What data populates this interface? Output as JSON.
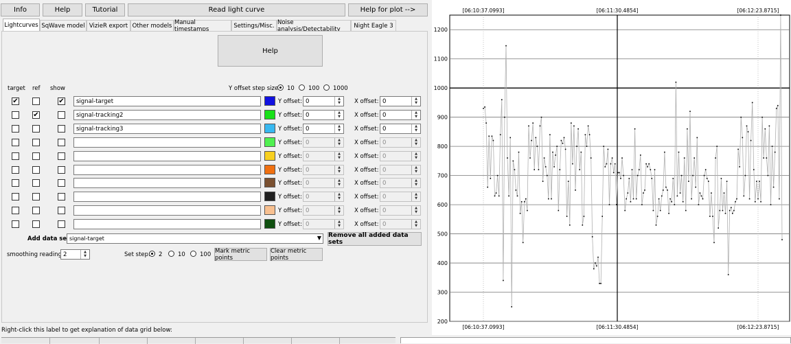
{
  "toolbar": {
    "info": "Info",
    "help": "Help",
    "tutorial": "Tutorial",
    "read_light_curve": "Read light curve",
    "help_for_plot": "Help for plot -->"
  },
  "tabs": [
    "Lightcurves",
    "SqWave model",
    "VizieR export",
    "Other models",
    "Manual timestamps",
    "Settings/Misc.",
    "Noise analysis/Detectability",
    "Night Eagle 3"
  ],
  "panel": {
    "help_button": "Help",
    "col_target": "target",
    "col_ref": "ref",
    "col_show": "show",
    "y_step_label": "Y offset step size:",
    "y_step_options": [
      "10",
      "100",
      "1000"
    ],
    "y_offset_label": "Y offset:",
    "x_offset_label": "X offset:",
    "add_data_set_label": "Add data set",
    "add_data_set_value": "signal-target",
    "remove_all_button": "Remove all added data sets",
    "smoothing_label": "smoothing readings",
    "smoothing_value": "2",
    "set_step_label": "Set step:",
    "set_step_options": [
      "2",
      "10",
      "100"
    ],
    "mark_metric_button": "Mark metric points",
    "clear_metric_button": "Clear metric points",
    "footer_text": "Right-click this label to get explanation of data grid below:"
  },
  "rows": [
    {
      "target": true,
      "ref": false,
      "show": true,
      "name": "signal-target",
      "color": "#1010e0",
      "y": "0",
      "x": "0",
      "enabled": true
    },
    {
      "target": false,
      "ref": true,
      "show": false,
      "name": "signal-tracking2",
      "color": "#18e018",
      "y": "0",
      "x": "0",
      "enabled": true
    },
    {
      "target": false,
      "ref": false,
      "show": false,
      "name": "signal-tracking3",
      "color": "#38b8f0",
      "y": "0",
      "x": "0",
      "enabled": true
    },
    {
      "target": false,
      "ref": false,
      "show": false,
      "name": "",
      "color": "#50f050",
      "y": "0",
      "x": "0",
      "enabled": false
    },
    {
      "target": false,
      "ref": false,
      "show": false,
      "name": "",
      "color": "#f8d020",
      "y": "0",
      "x": "0",
      "enabled": false
    },
    {
      "target": false,
      "ref": false,
      "show": false,
      "name": "",
      "color": "#f07010",
      "y": "0",
      "x": "0",
      "enabled": false
    },
    {
      "target": false,
      "ref": false,
      "show": false,
      "name": "",
      "color": "#7a5030",
      "y": "0",
      "x": "0",
      "enabled": false
    },
    {
      "target": false,
      "ref": false,
      "show": false,
      "name": "",
      "color": "#202020",
      "y": "0",
      "x": "0",
      "enabled": false
    },
    {
      "target": false,
      "ref": false,
      "show": false,
      "name": "",
      "color": "#f8c090",
      "y": "0",
      "x": "0",
      "enabled": false
    },
    {
      "target": false,
      "ref": false,
      "show": false,
      "name": "",
      "color": "#105010",
      "y": "0",
      "x": "0",
      "enabled": false
    }
  ],
  "plot": {
    "top_time_labels": [
      "[06:10:37.0993]",
      "[06:11:30.4854]",
      "[06:12:23.8715]"
    ],
    "bottom_time_labels": [
      "[06:10:37.0993]",
      "[06:11:30.4854]",
      "[06:12:23.8715]"
    ],
    "y_ticks": [
      "1200",
      "1100",
      "1000",
      "900",
      "800",
      "700",
      "600",
      "500",
      "400",
      "300",
      "200"
    ],
    "ylim": [
      200,
      1250
    ],
    "series": [
      930,
      935,
      880,
      660,
      835,
      690,
      835,
      820,
      630,
      640,
      700,
      630,
      840,
      960,
      340,
      900,
      1145,
      760,
      630,
      830,
      250,
      750,
      720,
      650,
      630,
      780,
      570,
      610,
      470,
      610,
      620,
      580,
      870,
      760,
      820,
      880,
      720,
      830,
      800,
      720,
      870,
      900,
      680,
      760,
      730,
      700,
      620,
      840,
      620,
      780,
      730,
      770,
      800,
      580,
      720,
      820,
      810,
      830,
      790,
      560,
      680,
      530,
      880,
      740,
      870,
      650,
      800,
      860,
      720,
      780,
      530,
      560,
      840,
      800,
      870,
      840,
      760,
      490,
      380,
      400,
      390,
      420,
      330,
      330,
      560,
      800,
      730,
      740,
      790,
      600,
      740,
      760,
      710,
      740,
      600,
      710,
      710,
      690,
      760,
      700,
      580,
      620,
      640,
      690,
      610,
      720,
      620,
      860,
      620,
      700,
      720,
      770,
      600,
      640,
      650,
      740,
      730,
      740,
      720,
      690,
      580,
      720,
      530,
      560,
      620,
      580,
      630,
      650,
      780,
      660,
      650,
      570,
      620,
      610,
      690,
      600,
      1020,
      630,
      780,
      640,
      700,
      610,
      760,
      580,
      860,
      680,
      920,
      620,
      700,
      760,
      660,
      830,
      600,
      640,
      630,
      620,
      700,
      720,
      690,
      680,
      560,
      640,
      560,
      470,
      760,
      800,
      520,
      580,
      690,
      580,
      640,
      570,
      680,
      360,
      580,
      590,
      570,
      580,
      610,
      620,
      790,
      730,
      900,
      830,
      630,
      700,
      870,
      850,
      620,
      820,
      950,
      720,
      610,
      680,
      620,
      680,
      610,
      900,
      760,
      860,
      760,
      700,
      870,
      600,
      800,
      660,
      780,
      930,
      940,
      620,
      1265,
      480
    ]
  }
}
